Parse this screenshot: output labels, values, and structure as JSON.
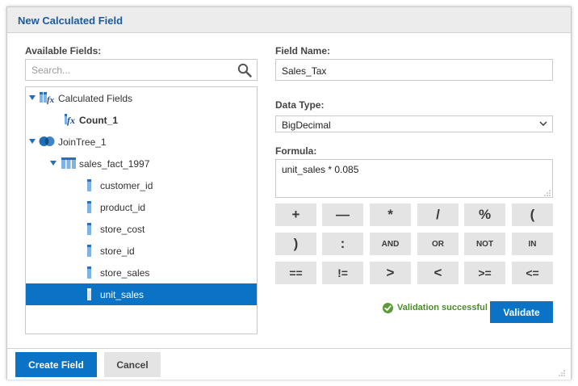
{
  "dialog": {
    "title": "New Calculated Field"
  },
  "fields_panel": {
    "label": "Available Fields:",
    "search_placeholder": "Search...",
    "tree": {
      "calculated_group": {
        "label": "Calculated Fields",
        "items": [
          "Count_1"
        ]
      },
      "jointree": {
        "label": "JoinTree_1",
        "table": {
          "label": "sales_fact_1997",
          "fields": [
            "customer_id",
            "product_id",
            "store_cost",
            "store_id",
            "store_sales",
            "unit_sales"
          ],
          "selected": "unit_sales"
        }
      }
    }
  },
  "field_name": {
    "label": "Field Name:",
    "value": "Sales_Tax"
  },
  "data_type": {
    "label": "Data Type:",
    "selected": "BigDecimal"
  },
  "formula": {
    "label": "Formula:",
    "value": "unit_sales * 0.085",
    "operators": [
      [
        "+",
        "—",
        "*",
        "/",
        "%",
        "("
      ],
      [
        ")",
        ":",
        "AND",
        "OR",
        "NOT",
        "IN"
      ],
      [
        "==",
        "!=",
        ">",
        "<",
        ">=",
        "<="
      ]
    ]
  },
  "validation": {
    "status_text": "Validation successful",
    "button_label": "Validate"
  },
  "footer": {
    "create_label": "Create Field",
    "cancel_label": "Cancel"
  },
  "colors": {
    "accent": "#0a73c6",
    "title_text": "#1c5a9c",
    "success": "#4a8d2a",
    "button_gray": "#e4e4e4"
  }
}
